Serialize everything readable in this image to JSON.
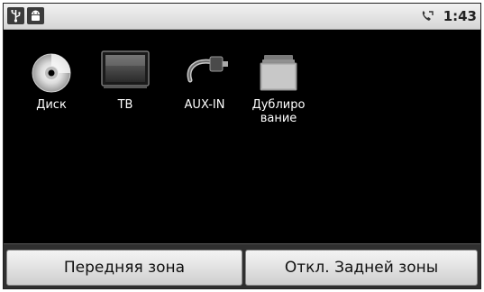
{
  "status_bar": {
    "left_icons": [
      "usb-icon",
      "android-debug-icon"
    ],
    "right_icons": [
      "phone-signal-icon"
    ],
    "time": "1:43"
  },
  "apps": [
    {
      "label": "Диск",
      "icon": "disc-icon"
    },
    {
      "label": "ТВ",
      "icon": "tv-icon"
    },
    {
      "label": "AUX-IN",
      "icon": "aux-cable-icon"
    },
    {
      "label": "Дублиро\nвание",
      "icon": "mirror-windows-icon"
    }
  ],
  "buttons": {
    "front_zone": "Передняя зона",
    "rear_zone_off": "Откл. Задней зоны"
  }
}
